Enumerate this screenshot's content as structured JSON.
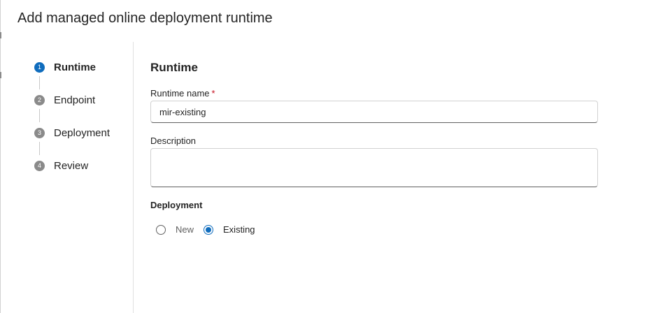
{
  "dialog": {
    "title": "Add managed online deployment runtime"
  },
  "stepper": {
    "steps": [
      {
        "number": "1",
        "label": "Runtime",
        "active": true
      },
      {
        "number": "2",
        "label": "Endpoint",
        "active": false
      },
      {
        "number": "3",
        "label": "Deployment",
        "active": false
      },
      {
        "number": "4",
        "label": "Review",
        "active": false
      }
    ]
  },
  "form": {
    "section_title": "Runtime",
    "runtime_name": {
      "label": "Runtime name",
      "required_marker": "*",
      "value": "mir-existing"
    },
    "description": {
      "label": "Description",
      "value": ""
    },
    "deployment": {
      "label": "Deployment",
      "options": [
        {
          "label": "New",
          "selected": false
        },
        {
          "label": "Existing",
          "selected": true
        }
      ]
    }
  },
  "colors": {
    "accent": "#0f6cbd",
    "required": "#c50f1f",
    "inactive_step": "#8a8a8a"
  }
}
